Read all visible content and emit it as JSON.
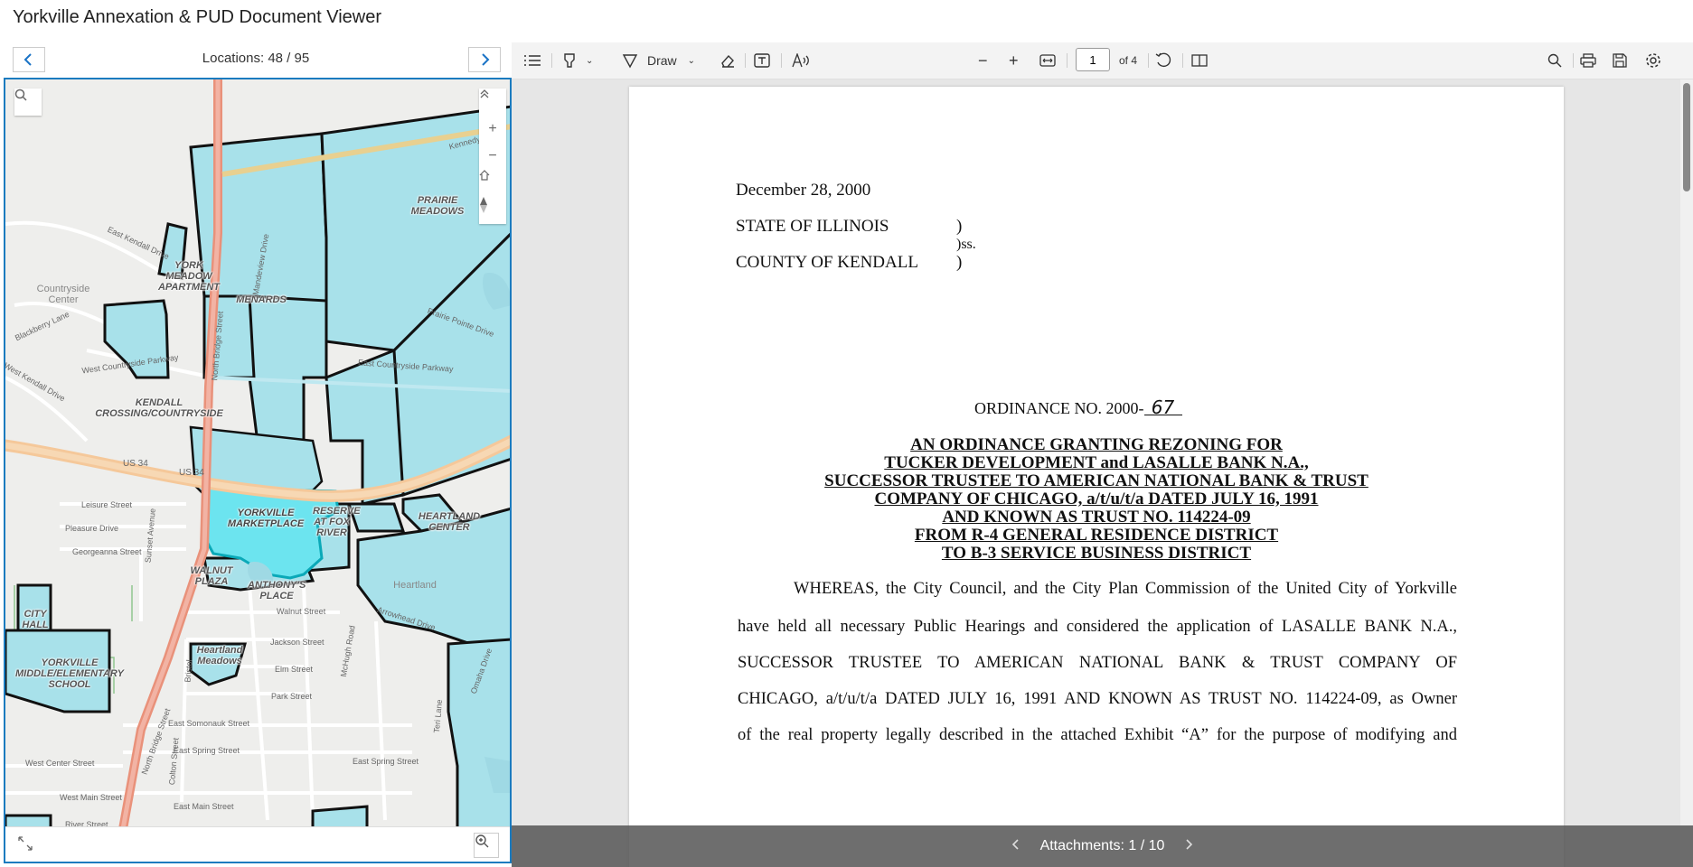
{
  "app": {
    "title": "Yorkville Annexation & PUD Document Viewer"
  },
  "locations": {
    "text": "Locations: 48 / 95",
    "prev_icon": "chevron-left-icon",
    "next_icon": "chevron-right-icon"
  },
  "map": {
    "labels": {
      "prairie_meadows": "PRAIRIE MEADOWS",
      "york_meadow": "YORK MEADOW APARTMENT",
      "menards": "MENARDS",
      "kendall_crossing": "KENDALL CROSSING/COUNTRYSIDE",
      "yorkville_marketplace": "YORKVILLE MARKETPLACE",
      "reserve_fox_river": "RESERVE AT FOX RIVER",
      "heartland_center": "HEARTLAND CENTER",
      "walnut_plaza": "WALNUT PLAZA",
      "anthonys_place": "ANTHONY'S PLACE",
      "city_hall": "CITY HALL",
      "yorkville_school": "YORKVILLE MIDDLE/ELEMENTARY SCHOOL",
      "heartland_meadows": "Heartland Meadows"
    },
    "places": {
      "countryside_center": "Countryside Center",
      "heartland": "Heartland"
    },
    "streets": {
      "kennedy_road": "Kennedy Road",
      "east_kendall_drive": "East Kendall Drive",
      "blackberry_lane": "Blackberry Lane",
      "west_countryside": "West Countryside Parkway",
      "west_kendall_drive": "West Kendall Drive",
      "east_countryside": "East Countryside Parkway",
      "prairie_pointe": "Prairie Pointe Drive",
      "us34_a": "US 34",
      "us34_b": "US 34",
      "leisure": "Leisure Street",
      "pleasure": "Pleasure Drive",
      "georgeanna": "Georgeanna Street",
      "walnut": "Walnut Street",
      "jackson": "Jackson Street",
      "elm": "Elm Street",
      "park": "Park Street",
      "east_somonauk": "East Somonauk Street",
      "east_spring": "East Spring Street",
      "east_spring_2": "East Spring Street",
      "west_center": "West Center Street",
      "west_main": "West Main Street",
      "east_main": "East Main Street",
      "river": "River Street",
      "arrowhead": "Arrowhead Drive",
      "north_bridge": "North Bridge Street",
      "north_bridge_2": "North Bridge Street",
      "mchugh": "McHugh Road",
      "teri_lane": "Teri Lane",
      "omaha": "Omaha Drive",
      "sunset": "Sunset Avenue",
      "mandeview": "Mandeview Drive",
      "bristol": "Bristol",
      "colton": "Colton Street"
    },
    "tools": [
      "search-icon",
      "collapse-icon",
      "zoom-in-icon",
      "zoom-out-icon",
      "home-icon",
      "compass-icon",
      "expand-icon",
      "zoom-to-icon"
    ],
    "colors": {
      "parcel_fill": "#a8e1ea",
      "selected_fill": "#6ce4ef",
      "road_major": "#f5c89a",
      "road_bridge": "#e9917a"
    }
  },
  "toolbar": {
    "draw_label": "Draw",
    "page_value": "1",
    "page_of": "of 4",
    "icons": [
      "list-icon",
      "highlight-icon",
      "draw-icon",
      "eraser-icon",
      "text-box-icon",
      "read-aloud-icon",
      "zoom-out-icon",
      "zoom-in-icon",
      "fit-width-icon",
      "rotate-icon",
      "two-page-icon",
      "search-icon",
      "print-icon",
      "save-icon",
      "settings-icon"
    ]
  },
  "document": {
    "date": "December 28, 2000",
    "state_line": "STATE OF ILLINOIS",
    "paren1": ")",
    "ss": ")ss.",
    "county_line": "COUNTY OF KENDALL",
    "paren2": ")",
    "ordinance_label": "ORDINANCE NO. 2000-",
    "ordinance_number": "67",
    "heading": [
      "AN ORDINANCE GRANTING REZONING FOR",
      "TUCKER DEVELOPMENT and LASALLE BANK N.A.,",
      "SUCCESSOR TRUSTEE TO AMERICAN NATIONAL BANK & TRUST",
      "COMPANY OF CHICAGO, a/t/u/t/a DATED JULY 16, 1991",
      "AND KNOWN AS TRUST NO. 114224-09",
      "FROM R-4 GENERAL RESIDENCE DISTRICT",
      "TO B-3 SERVICE BUSINESS DISTRICT"
    ],
    "body": [
      "WHEREAS, the City Council, and the City Plan Commission of the United City of Yorkville",
      "have held all necessary Public Hearings and considered the application of LASALLE BANK N.A.,",
      "SUCCESSOR TRUSTEE TO AMERICAN NATIONAL BANK & TRUST COMPANY OF",
      "CHICAGO, a/t/u/t/a DATED JULY 16, 1991 AND KNOWN AS TRUST NO. 114224-09, as Owner",
      "of the real property legally described in the attached Exhibit “A” for the purpose of modifying and"
    ]
  },
  "attachments": {
    "text": "Attachments: 1 / 10",
    "prev_icon": "chevron-left-icon",
    "next_icon": "chevron-right-icon"
  }
}
